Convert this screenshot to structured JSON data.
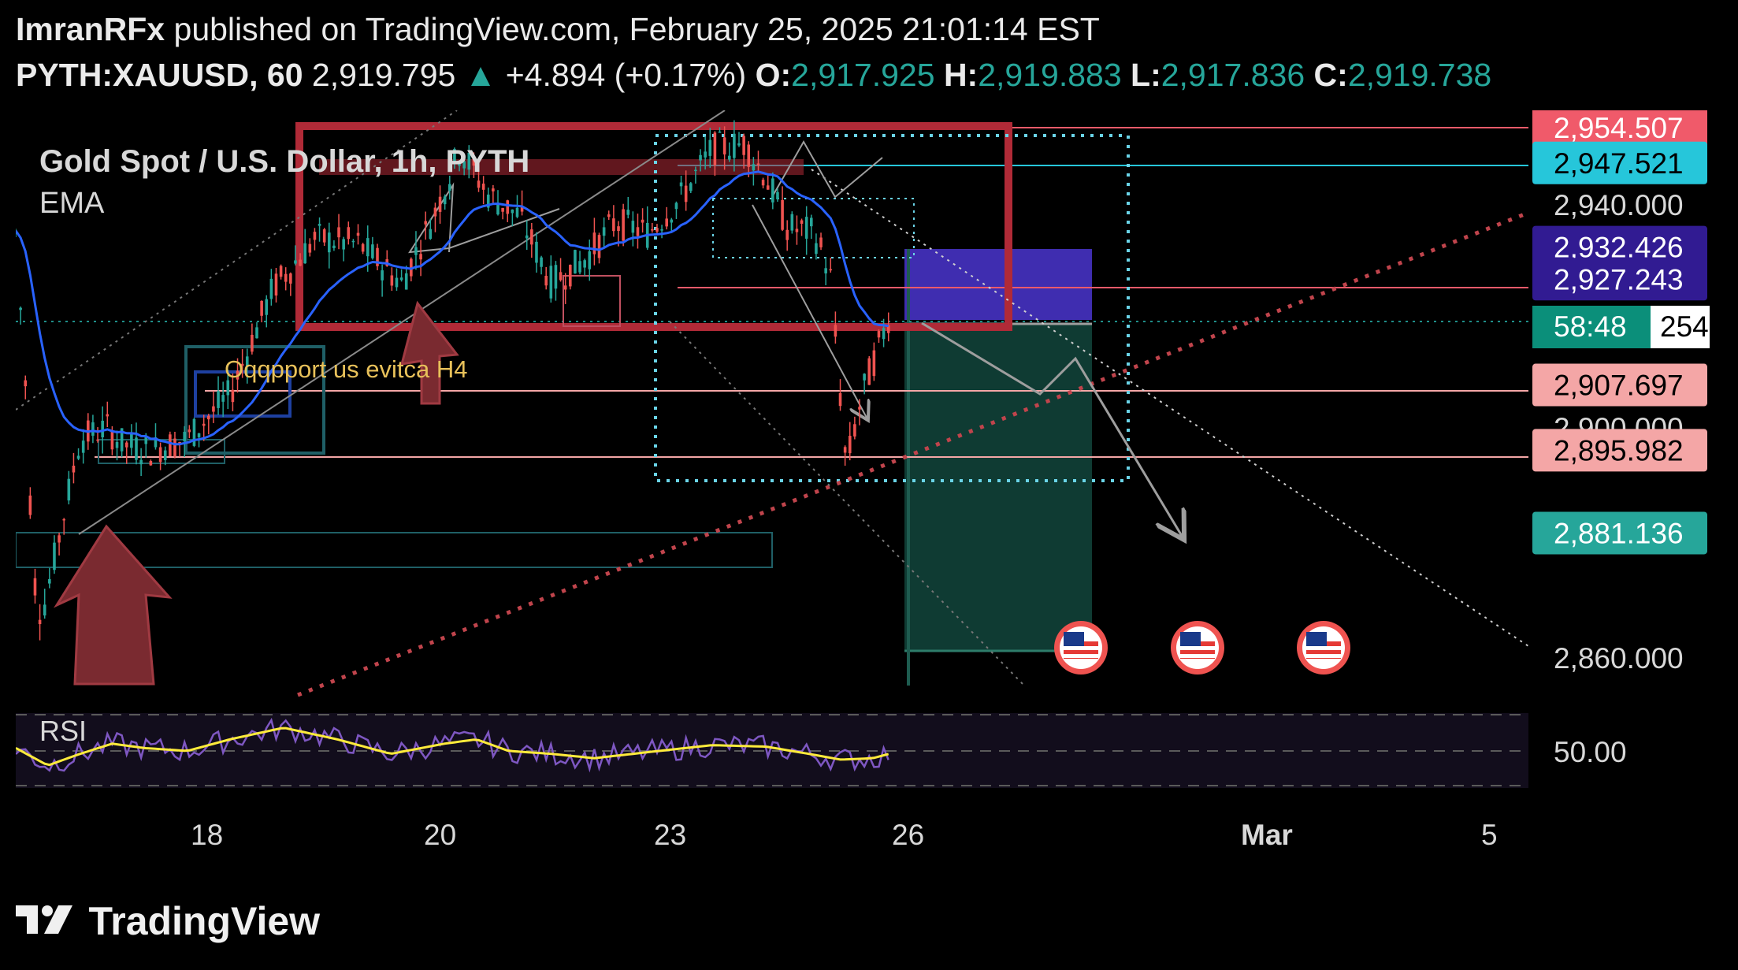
{
  "header": {
    "author": "ImranRFx",
    "published_text": "published on TradingView.com, February 25, 2025 21:01:14 EST",
    "symbol": "PYTH:XAUUSD, 60",
    "last_price": "2,919.795",
    "change_arrow": "▲",
    "change": "+4.894 (+0.17%)",
    "o_label": "O:",
    "o_value": "2,917.925",
    "h_label": "H:",
    "h_value": "2,919.883",
    "l_label": "L:",
    "l_value": "2,917.836",
    "c_label": "C:",
    "c_value": "2,919.738"
  },
  "chart": {
    "instrument_title": "Gold Spot / U.S. Dollar, 1h, PYTH",
    "ema_label": "EMA",
    "annotation_text": "Oqqpport us evitca H4",
    "rsi_label": "RSI",
    "rsi_tick": "50.00",
    "countdown": "58:48",
    "last_price_partial": "254",
    "price_ticks": [
      "2,940.000",
      "2,900.000",
      "2,860.000"
    ],
    "price_tags": [
      {
        "text": "2,954.507",
        "bg": "#f05a6a",
        "fg": "#ffffff"
      },
      {
        "text": "2,947.521",
        "bg": "#26c6da",
        "fg": "#000000"
      },
      {
        "text": "2,932.426",
        "bg": "#311b92",
        "fg": "#ffffff"
      },
      {
        "text": "2,927.243",
        "bg": "#311b92",
        "fg": "#ffffff"
      },
      {
        "text": "2,907.697",
        "bg": "#f4a6a6",
        "fg": "#000000"
      },
      {
        "text": "2,895.982",
        "bg": "#f4a6a6",
        "fg": "#000000"
      },
      {
        "text": "2,881.136",
        "bg": "#26a69a",
        "fg": "#ffffff"
      }
    ],
    "date_ticks": [
      {
        "label": "18",
        "bold": false
      },
      {
        "label": "20",
        "bold": false
      },
      {
        "label": "23",
        "bold": false
      },
      {
        "label": "26",
        "bold": false
      },
      {
        "label": "Mar",
        "bold": true
      },
      {
        "label": "5",
        "bold": false
      }
    ],
    "event_icons": [
      "us-flag-icon",
      "us-flag-icon",
      "us-flag-icon"
    ],
    "colors": {
      "up": "#26a69a",
      "down": "#ef5350",
      "ema": "#2962ff",
      "rsi_line": "#7e57c2",
      "rsi_ma": "#ffeb3b",
      "resistance_box": "#b02a37",
      "stop_zone": "#3f2db0",
      "target_zone": "#0f3b33"
    }
  },
  "chart_data": {
    "type": "candlestick",
    "title": "Gold Spot / U.S. Dollar, 1h, PYTH",
    "indicators": [
      "EMA",
      "RSI"
    ],
    "x_ticks": [
      "18",
      "20",
      "23",
      "26",
      "Mar",
      "5"
    ],
    "y_ticks": [
      2940,
      2900,
      2860
    ],
    "ylim": [
      2845,
      2958
    ],
    "marked_levels": [
      2954.507,
      2947.521,
      2932.426,
      2927.243,
      2907.697,
      2895.982,
      2881.136
    ],
    "last": 2919.795,
    "ohlc_last": {
      "o": 2917.925,
      "h": 2919.883,
      "l": 2917.836,
      "c": 2919.738
    },
    "price_path": [
      [
        0,
        2935
      ],
      [
        10,
        2905
      ],
      [
        16,
        2874
      ],
      [
        24,
        2866
      ],
      [
        40,
        2880
      ],
      [
        60,
        2898
      ],
      [
        85,
        2900
      ],
      [
        100,
        2897
      ],
      [
        125,
        2896
      ],
      [
        160,
        2898
      ],
      [
        200,
        2906
      ],
      [
        240,
        2925
      ],
      [
        280,
        2934
      ],
      [
        320,
        2933
      ],
      [
        360,
        2926
      ],
      [
        390,
        2938
      ],
      [
        415,
        2950
      ],
      [
        440,
        2942
      ],
      [
        470,
        2938
      ],
      [
        500,
        2926
      ],
      [
        530,
        2930
      ],
      [
        560,
        2937
      ],
      [
        590,
        2935
      ],
      [
        620,
        2941
      ],
      [
        650,
        2950
      ],
      [
        680,
        2951
      ],
      [
        700,
        2945
      ],
      [
        720,
        2936
      ],
      [
        745,
        2935
      ],
      [
        760,
        2928
      ],
      [
        775,
        2893
      ],
      [
        790,
        2906
      ],
      [
        815,
        2920
      ]
    ],
    "rsi_ma_path": [
      [
        0,
        52
      ],
      [
        30,
        40
      ],
      [
        60,
        48
      ],
      [
        90,
        55
      ],
      [
        120,
        52
      ],
      [
        160,
        50
      ],
      [
        200,
        58
      ],
      [
        250,
        66
      ],
      [
        300,
        58
      ],
      [
        350,
        48
      ],
      [
        400,
        55
      ],
      [
        430,
        58
      ],
      [
        460,
        50
      ],
      [
        500,
        48
      ],
      [
        540,
        45
      ],
      [
        600,
        50
      ],
      [
        650,
        54
      ],
      [
        700,
        53
      ],
      [
        740,
        48
      ],
      [
        770,
        44
      ],
      [
        800,
        45
      ],
      [
        815,
        48
      ]
    ],
    "rsi_ylim": [
      25,
      75
    ]
  }
}
